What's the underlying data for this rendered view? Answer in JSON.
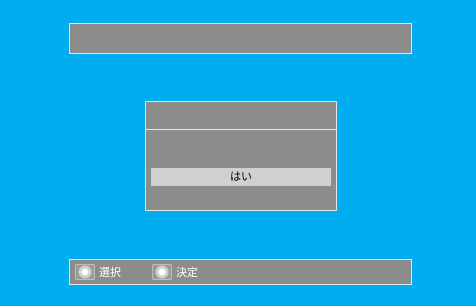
{
  "title_bar": {
    "text": ""
  },
  "dialog": {
    "header_text": "",
    "option_yes": "はい"
  },
  "footer": {
    "hints": [
      {
        "icon": "dpad-icon",
        "label": "選択"
      },
      {
        "icon": "enter-button-icon",
        "label": "決定"
      }
    ]
  },
  "colors": {
    "background": "#00aeef",
    "panel": "#8c8c8c",
    "panel_border": "#e6e6e6",
    "highlight": "#d0d0d0"
  }
}
